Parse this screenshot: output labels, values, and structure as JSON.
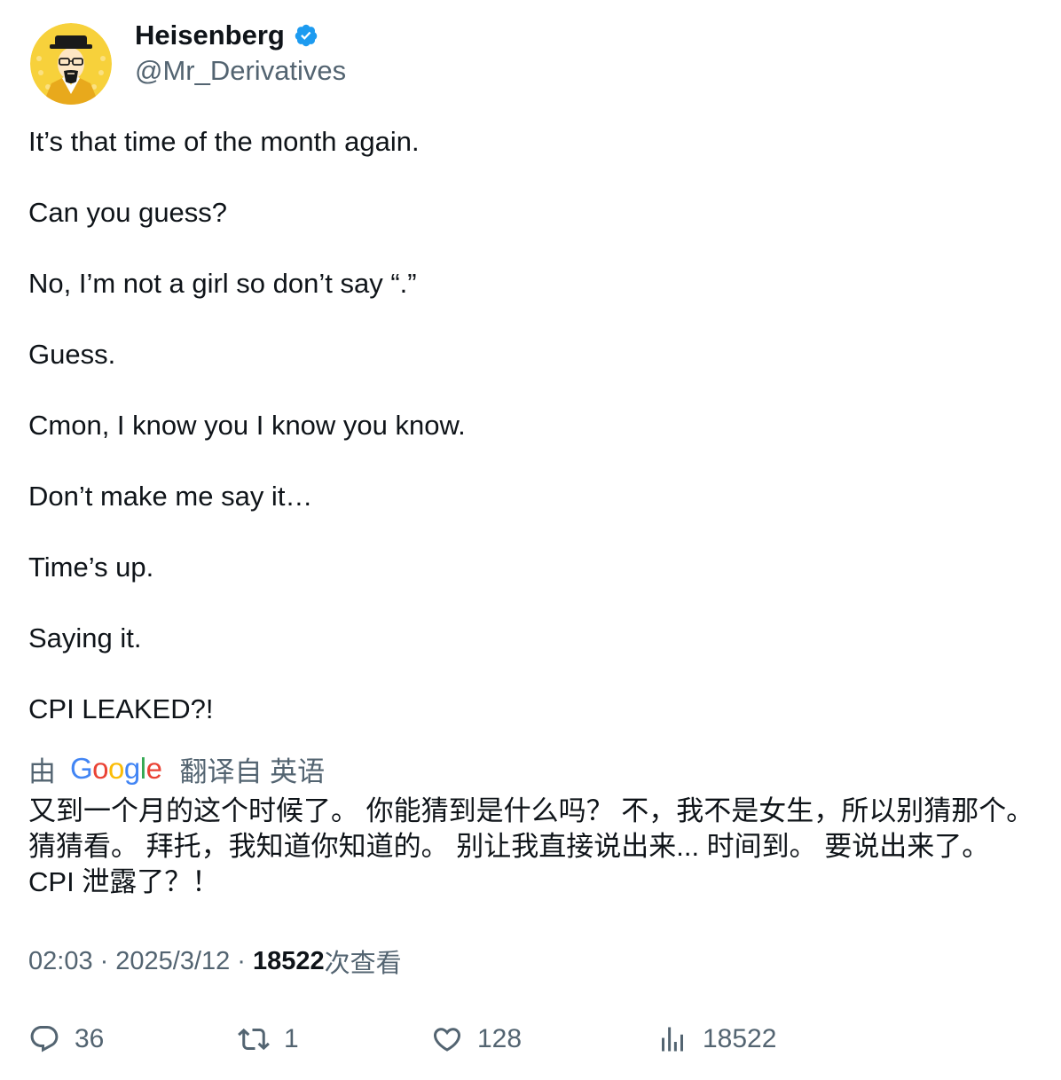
{
  "author": {
    "display_name": "Heisenberg",
    "handle": "@Mr_Derivatives",
    "verified": true,
    "verified_color": "#1d9bf0",
    "avatar_bg": "#f7d13b"
  },
  "tweet": {
    "lines": [
      "It’s that time of the month again.",
      "Can you guess?",
      "No, I’m not a girl so don’t say “.”",
      "Guess.",
      "Cmon, I know you I know you know.",
      "Don’t make me say it…",
      "Time’s up.",
      "Saying it.",
      "CPI LEAKED?!"
    ]
  },
  "translation": {
    "prefix": "由",
    "provider": "Google",
    "suffix": "翻译自 英语",
    "text": "又到一个月的这个时候了。 你能猜到是什么吗？ 不，我不是女生，所以别猜那个。 猜猜看。 拜托，我知道你知道的。 别让我直接说出来... 时间到。 要说出来了。 CPI 泄露了？！"
  },
  "meta": {
    "time": "02:03",
    "date": "2025/3/12",
    "views_count": "18522",
    "views_label": "次查看"
  },
  "actions": {
    "replies": "36",
    "retweets": "1",
    "likes": "128",
    "views": "18522"
  },
  "colors": {
    "text": "#0f1419",
    "secondary": "#536471"
  }
}
